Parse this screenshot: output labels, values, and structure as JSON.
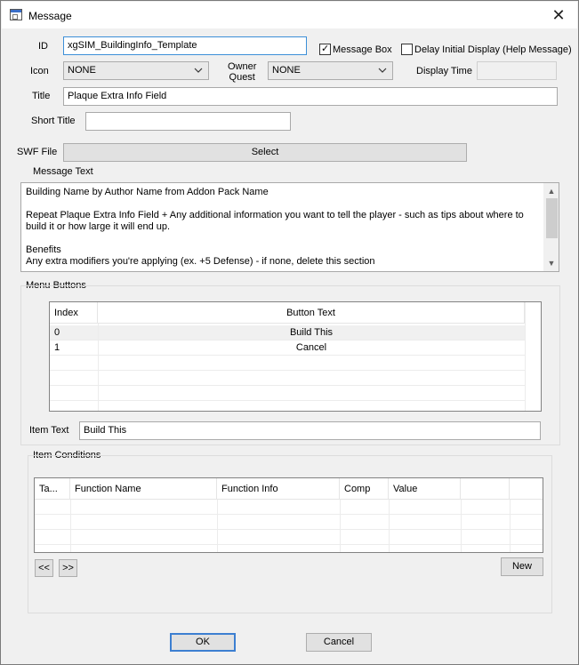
{
  "window": {
    "title": "Message",
    "close_glyph": "✕"
  },
  "fields": {
    "id_label": "ID",
    "id_value": "xgSIM_BuildingInfo_Template",
    "message_box_label": "Message Box",
    "message_box_checked": true,
    "delay_label": "Delay Initial Display (Help Message)",
    "delay_checked": false,
    "icon_label": "Icon",
    "icon_value": "NONE",
    "owner_quest_label_line1": "Owner",
    "owner_quest_label_line2": "Quest",
    "owner_quest_value": "NONE",
    "display_time_label": "Display Time",
    "display_time_value": "",
    "title_label": "Title",
    "title_value": "Plaque Extra Info Field",
    "short_title_label": "Short Title",
    "short_title_value": "",
    "swf_label": "SWF File",
    "swf_button": "Select",
    "message_text_label": "Message Text"
  },
  "message_text": {
    "lines": [
      "Building Name by Author Name from Addon Pack Name",
      "",
      "Repeat Plaque Extra Info Field + Any additional information you want to tell the player - such as tips about where to",
      "build it or how large it will end up.",
      "",
      "Benefits",
      "Any extra modifiers you're applying (ex. +5 Defense) - if none, delete this section"
    ]
  },
  "menu_buttons": {
    "group_label": "Menu Buttons",
    "columns": [
      "Index",
      "Button Text"
    ],
    "rows": [
      {
        "index": "0",
        "text": "Build This",
        "selected": true
      },
      {
        "index": "1",
        "text": "Cancel",
        "selected": false
      }
    ],
    "item_text_label": "Item Text",
    "item_text_value": "Build This"
  },
  "item_conditions": {
    "group_label": "Item Conditions",
    "columns": [
      "Ta...",
      "Function Name",
      "Function Info",
      "Comp",
      "Value",
      "",
      ""
    ],
    "rows": [],
    "prev_button": "<<",
    "next_button": ">>",
    "new_button": "New"
  },
  "footer": {
    "ok_button": "OK",
    "cancel_button": "Cancel"
  },
  "colors": {
    "focus_border": "#3c8fd8",
    "default_button_border": "#3c7fd1"
  }
}
